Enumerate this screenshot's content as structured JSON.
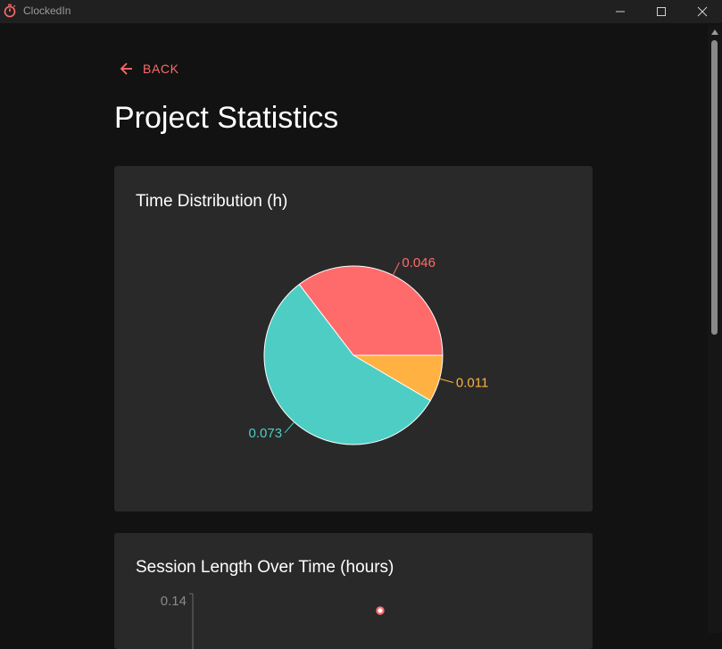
{
  "window": {
    "title": "ClockedIn"
  },
  "nav": {
    "back_label": "BACK"
  },
  "page": {
    "title": "Project Statistics"
  },
  "colors": {
    "accent": "#ff6b6b",
    "slice_red": "#ff6b6b",
    "slice_teal": "#4ecdc4",
    "slice_orange": "#ffb142"
  },
  "time_distribution": {
    "title": "Time Distribution (h)"
  },
  "session_length": {
    "title": "Session Length Over Time (hours)"
  },
  "chart_data": [
    {
      "type": "pie",
      "title": "Time Distribution (h)",
      "values": [
        0.046,
        0.011,
        0.073
      ],
      "labels": [
        "0.046",
        "0.011",
        "0.073"
      ],
      "colors": [
        "#ff6b6b",
        "#ffb142",
        "#4ecdc4"
      ]
    },
    {
      "type": "line",
      "title": "Session Length Over Time (hours)",
      "y_tick_labels": [
        "0.14"
      ],
      "y": [
        0.14
      ]
    }
  ]
}
